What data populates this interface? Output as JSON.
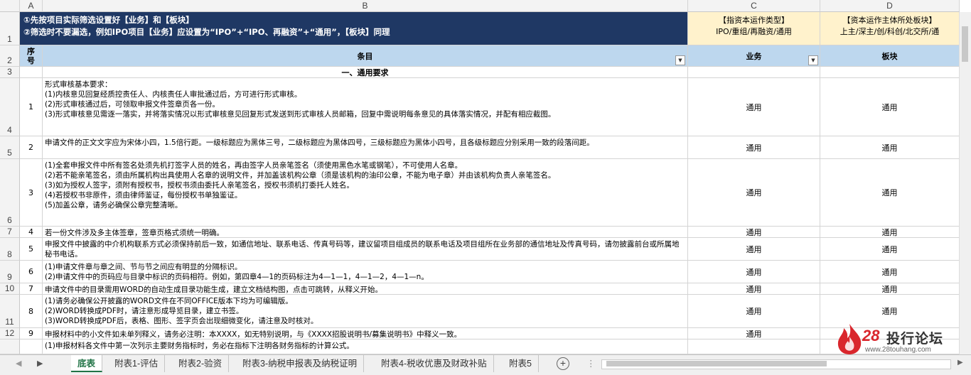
{
  "columns": [
    "A",
    "B",
    "C",
    "D"
  ],
  "rows": [
    "1",
    "2",
    "3",
    "4",
    "5",
    "6",
    "7",
    "8",
    "9",
    "10",
    "11",
    "12"
  ],
  "header": {
    "line1": "①先按项目实际筛选设置好【业务】和【板块】",
    "line2": "②筛选时不要漏选，例如IPO项目【业务】应设置为“IPO”+“IPO、再融资”+“通用”，【板块】同理",
    "c_line1": "【指资本运作类型】",
    "c_line2": "IPO/重组/再融资/通用",
    "d_line1": "【资本运作主体所处板块】",
    "d_line2": "上主/深主/创/科创/北交所/通"
  },
  "subheader": {
    "seq": "序\n号",
    "item": "条目",
    "business": "业务",
    "sector": "板块"
  },
  "section": "一、通用要求",
  "entries": [
    {
      "no": "1",
      "text": "形式审核基本要求：\n(1)内核意见回复经质控责任人、内核责任人审批通过后，方可进行形式审核。\n(2)形式审核通过后，可领取申报文件签章页各一份。\n(3)形式审核意见需逐一落实，并将落实情况以形式审核意见回复形式发送到形式审核人员邮箱，回复中需说明每条意见的具体落实情况，并配有相应截图。",
      "c": "通用",
      "d": "通用"
    },
    {
      "no": "2",
      "text": "申请文件的正文文字应为宋体小四，1.5倍行距。一级标题应为黑体三号，二级标题应为黑体四号，三级标题应为黑体小四号，且各级标题应分别采用一致的段落间距。",
      "c": "通用",
      "d": "通用"
    },
    {
      "no": "3",
      "text": "(1)全套申报文件中所有签名处须先机打签字人员的姓名，再由签字人员亲笔签名（须使用黑色水笔或钢笔），不可使用人名章。\n(2)若不能亲笔签名，须由所属机构出具使用人名章的说明文件，并加盖该机构公章（须是该机构的油印公章，不能为电子章）并由该机构负责人亲笔签名。\n(3)如为授权人签字，须附有授权书，授权书须由委托人亲笔签名，授权书须机打委托人姓名。\n(4)若授权书非原件，须由律师鉴证，每份授权书单独鉴证。\n(5)加盖公章，请务必确保公章完整清晰。",
      "c": "通用",
      "d": "通用"
    },
    {
      "no": "4",
      "text": "若一份文件涉及多主体签章，签章页格式须统一明确。",
      "c": "通用",
      "d": "通用"
    },
    {
      "no": "5",
      "text": "申报文件中披露的中介机构联系方式必须保持前后一致，如通信地址、联系电话、传真号码等，建议留项目组成员的联系电话及项目组所在业务部的通信地址及传真号码，请勿披露前台或所属地秘书电话。",
      "c": "通用",
      "d": "通用"
    },
    {
      "no": "6",
      "text": "(1)申请文件章与章之间、节与节之间应有明显的分隔标识。\n(2)申请文件中的页码应与目录中标识的页码相符。例如，第四章4—1的页码标注为4—1—1，4—1—2，4—1—n。",
      "c": "通用",
      "d": "通用"
    },
    {
      "no": "7",
      "text": "申请文件中的目录需用WORD的自动生成目录功能生成，建立文档结构图，点击可跳转，从释义开始。",
      "c": "通用",
      "d": "通用"
    },
    {
      "no": "8",
      "text": "(1)请务必确保公开披露的WORD文件在不同OFFICE版本下均为可编辑版。\n(2)WORD转换成PDF时，请注意形成导览目录，建立书签。\n(3)WORD转换成PDF后，表格、图形、签字页会出现细微变化，请注意及时核对。",
      "c": "通用",
      "d": "通用"
    },
    {
      "no": "9",
      "text": "申报材料中的小文件如未单列释义，请务必注明：本XXXX，如无特别说明，与《XXXX招股说明书/募集说明书》中释义一致。",
      "c": "通用",
      "d": ""
    },
    {
      "no": "",
      "text": "(1)申报材料各文件中第一次列示主要财务指标时，务必在指标下注明各财务指标的计算公式。",
      "c": "",
      "d": ""
    }
  ],
  "tabs": [
    "底表",
    "附表1-评估",
    "附表2-验资",
    "附表3-纳税申报表及纳税证明",
    "附表4-税收优惠及财政补贴",
    "附表5"
  ],
  "add_sheet": "+",
  "watermark": {
    "brand": "28",
    "text": "投行论坛",
    "url": "www.28touhang.com"
  },
  "colors": {
    "navy": "#1f3864",
    "yellow": "#fff2cc",
    "lightblue": "#bdd7ee",
    "excel_green": "#217346",
    "brand_red": "#d9262c"
  }
}
